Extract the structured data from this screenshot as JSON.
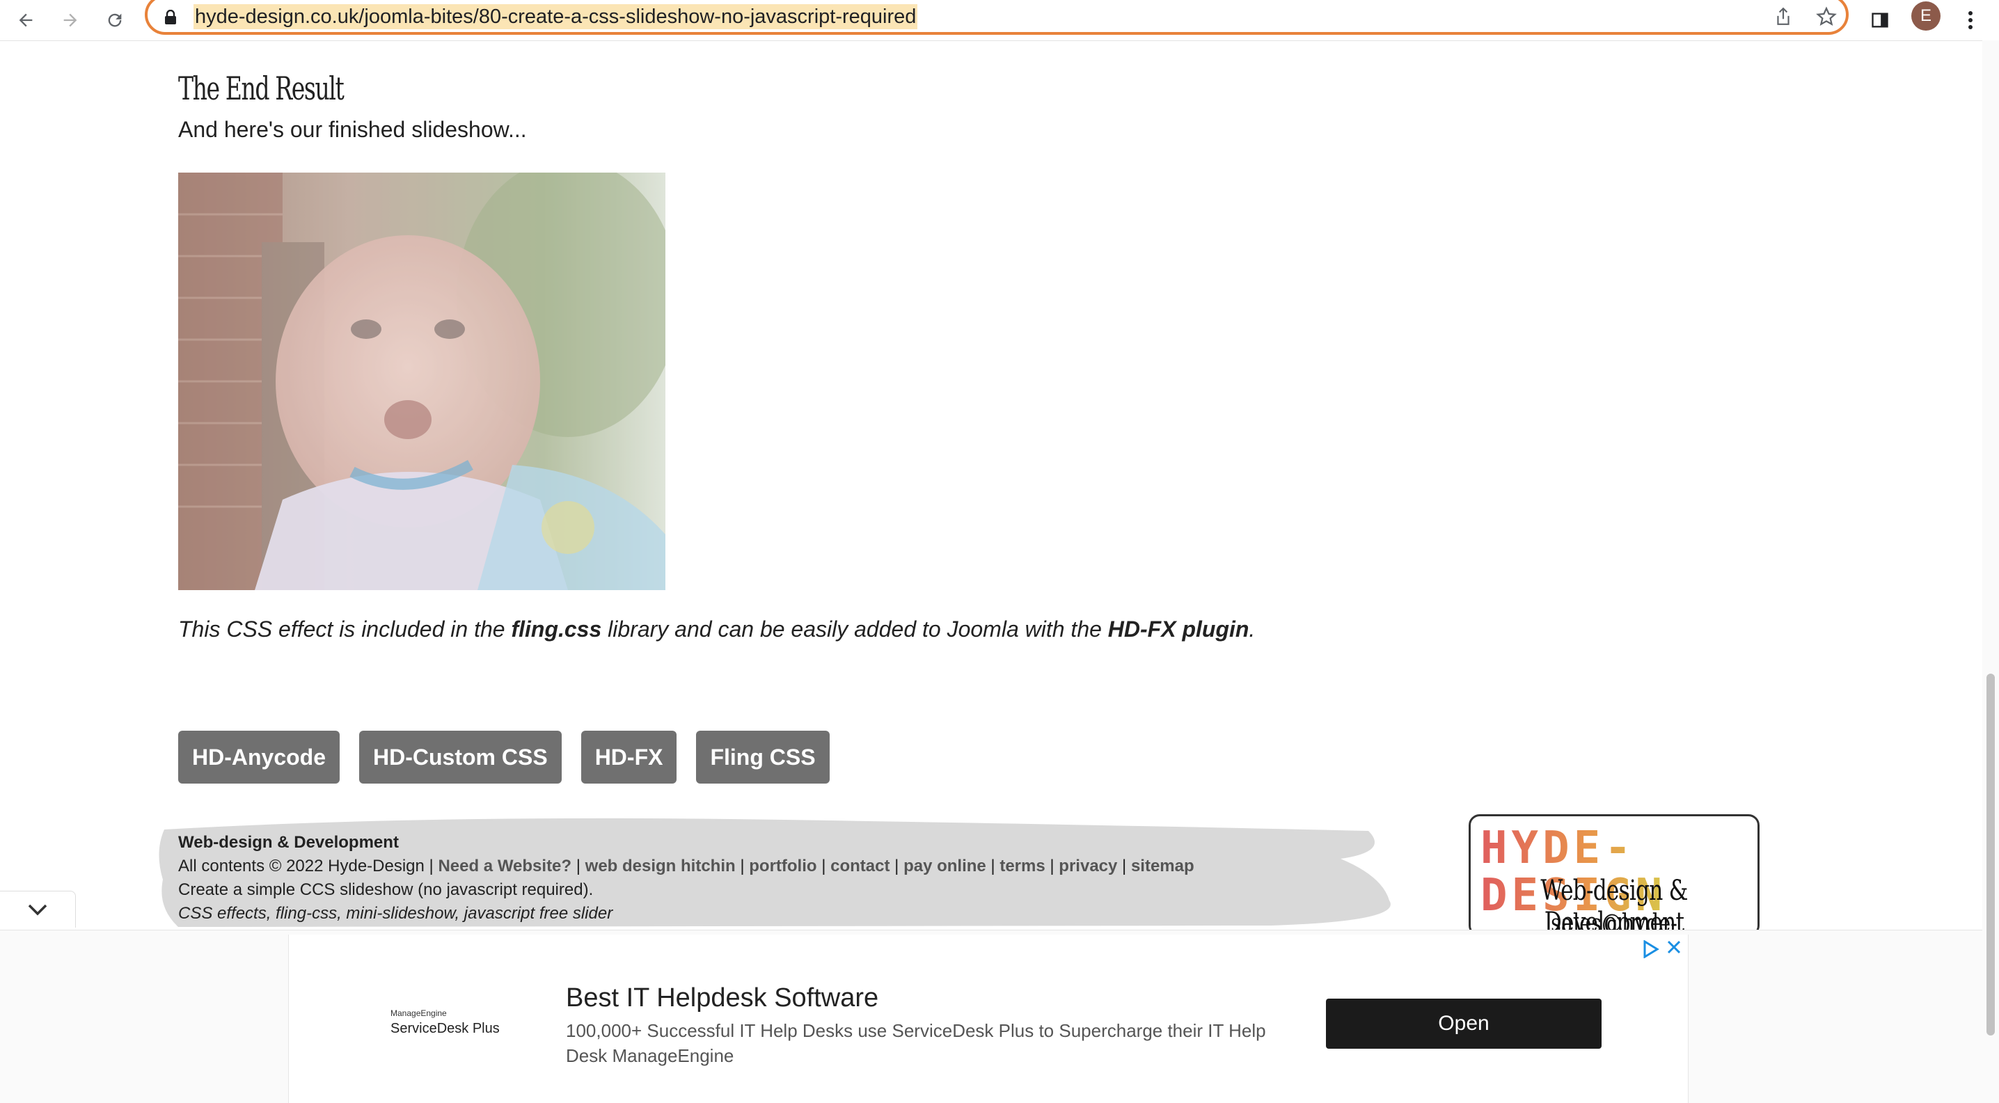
{
  "browser": {
    "url": "hyde-design.co.uk/joomla-bites/80-create-a-css-slideshow-no-javascript-required",
    "profile_initial": "E",
    "icons": [
      "back-arrow-icon",
      "forward-arrow-icon",
      "reload-icon",
      "lock-icon",
      "share-icon",
      "star-icon",
      "side-panel-icon",
      "kebab-menu-icon"
    ]
  },
  "article": {
    "section_title": "The End Result",
    "intro": "And here's our finished slideshow...",
    "credit": {
      "prefix": "This CSS effect is included in the ",
      "library": "fling.css",
      "middle": " library and can be easily added to Joomla with the ",
      "plugin": "HD-FX plugin",
      "suffix": "."
    },
    "tags": [
      "HD-Anycode",
      "HD-Custom CSS",
      "HD-FX",
      "Fling CSS"
    ]
  },
  "footer": {
    "heading": "Web-design & Development",
    "copyright": "All contents © 2022 Hyde-Design | ",
    "links": [
      "Need a Website?",
      "web design hitchin",
      "portfolio",
      "contact",
      "pay online",
      "terms",
      "privacy",
      "sitemap"
    ],
    "description": "Create a simple CCS slideshow (no javascript required).",
    "keywords": "CSS effects, fling-css, mini-slideshow, javascript free slider",
    "logo": {
      "brand": "HYDE-DESIGN",
      "tagline": "Web-design & Development",
      "email": "sales@hyde-design.co.uk"
    }
  },
  "ad": {
    "brand_small": "ManageEngine",
    "brand": "ServiceDesk Plus",
    "title": "Best IT Helpdesk Software",
    "description": "100,000+ Successful IT Help Desks use ServiceDesk Plus to Supercharge their IT Help Desk ManageEngine",
    "cta": "Open"
  },
  "colors": {
    "omnibox_border": "#e8823a",
    "url_highlight": "#fbe5b5",
    "tag_bg": "#707070",
    "ad_button": "#1b1b1b",
    "ad_choices": "#1a8fe3"
  }
}
